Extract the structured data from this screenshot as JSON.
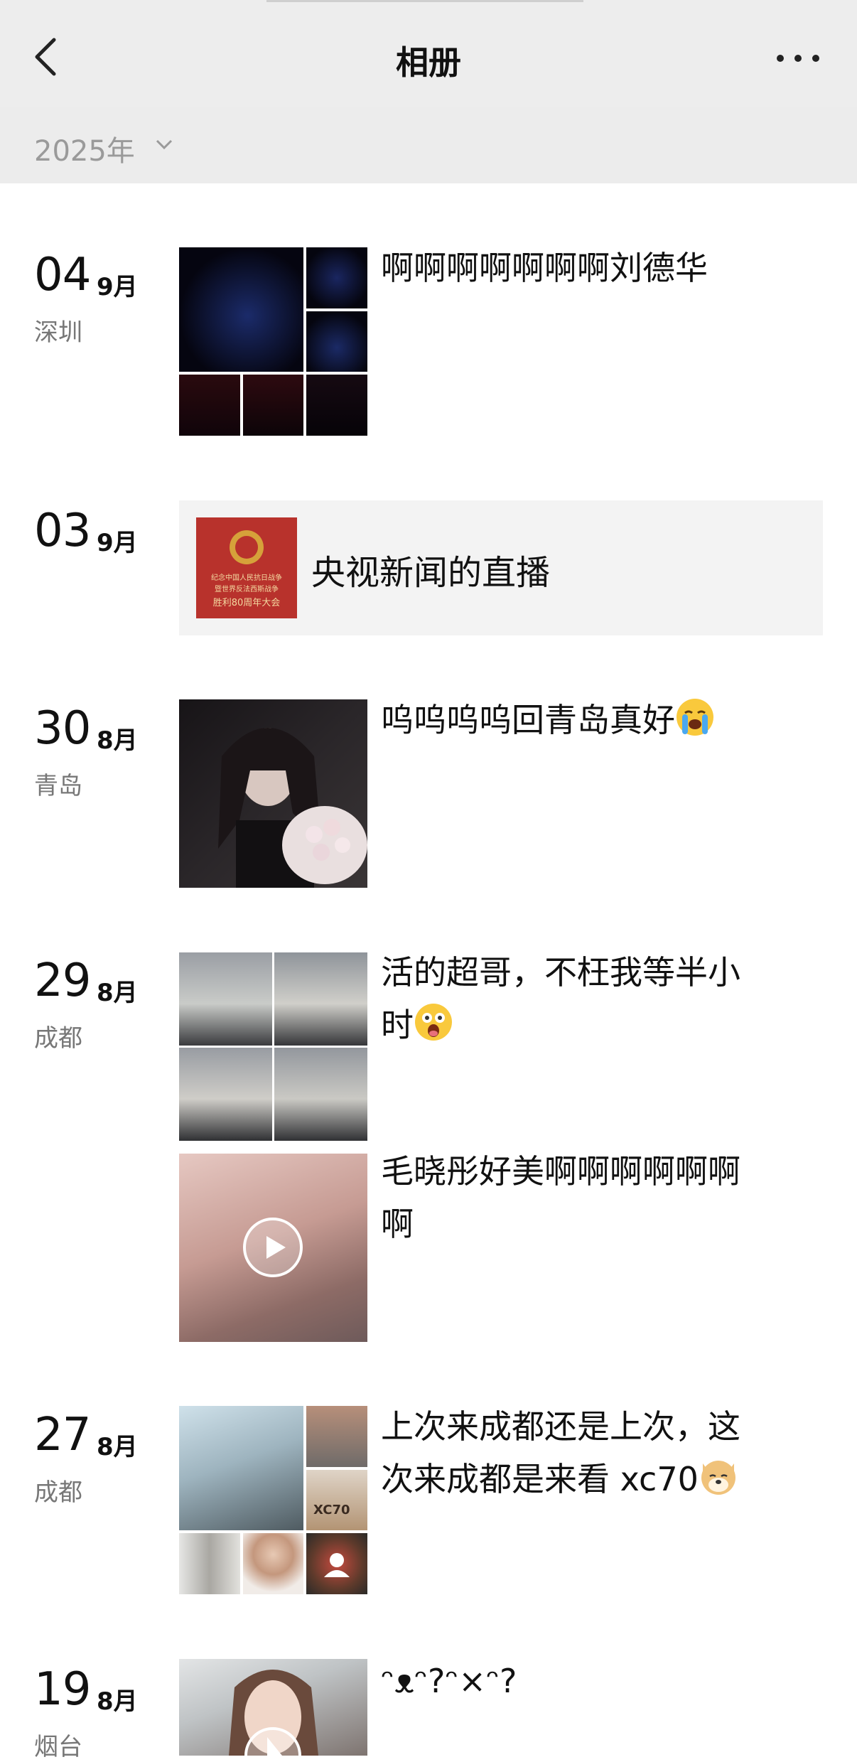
{
  "header": {
    "title": "相册"
  },
  "year_selector": {
    "label": "2025年"
  },
  "entries": [
    {
      "day": "04",
      "month": "9月",
      "location": "深圳",
      "posts": [
        {
          "text": "啊啊啊啊啊啊啊刘德华"
        }
      ]
    },
    {
      "day": "03",
      "month": "9月",
      "location": "",
      "share": {
        "text": "央视新闻的直播",
        "thumb_lines": [
          "纪念中国人民抗日战争",
          "暨世界反法西斯战争",
          "胜利80周年大会"
        ]
      }
    },
    {
      "day": "30",
      "month": "8月",
      "location": "青岛",
      "posts": [
        {
          "text": "呜呜呜呜回青岛真好"
        }
      ]
    },
    {
      "day": "29",
      "month": "8月",
      "location": "成都",
      "posts": [
        {
          "text_l1": "活的超哥，不枉我等半小",
          "text_l2": "时"
        },
        {
          "text_l1": "毛晓彤好美啊啊啊啊啊啊",
          "text_l2": "啊"
        }
      ]
    },
    {
      "day": "27",
      "month": "8月",
      "location": "成都",
      "posts": [
        {
          "text_l1": "上次来成都还是上次，这",
          "text_l2": "次来成都是来看 xc70"
        }
      ],
      "thumb_label": "XC70"
    },
    {
      "day": "19",
      "month": "8月",
      "location": "烟台",
      "posts": [
        {
          "text": "ᵔᴥᵔ?ᵔ×ᵔ?"
        }
      ]
    }
  ],
  "colors": {
    "header_bg": "#ededed",
    "year_bg": "#ececec",
    "share_bg": "#f3f3f3",
    "share_thumb": "#b8322c"
  }
}
